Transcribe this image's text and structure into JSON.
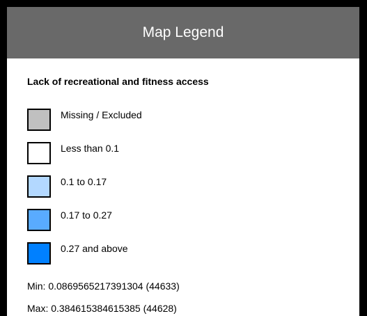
{
  "header": {
    "title": "Map Legend",
    "background": "#696969"
  },
  "legend": {
    "title": "Lack of recreational and fitness access",
    "items": [
      {
        "label": "Missing / Excluded",
        "color": "#c0c0c0"
      },
      {
        "label": "Less than 0.1",
        "color": "#ffffff"
      },
      {
        "label": "0.1 to 0.17",
        "color": "#b3d8ff"
      },
      {
        "label": "0.17 to 0.27",
        "color": "#59abff"
      },
      {
        "label": "0.27 and above",
        "color": "#0080ff"
      }
    ]
  },
  "stats": {
    "min": "Min: 0.0869565217391304 (44633)",
    "max": "Max: 0.384615384615385 (44628)"
  }
}
